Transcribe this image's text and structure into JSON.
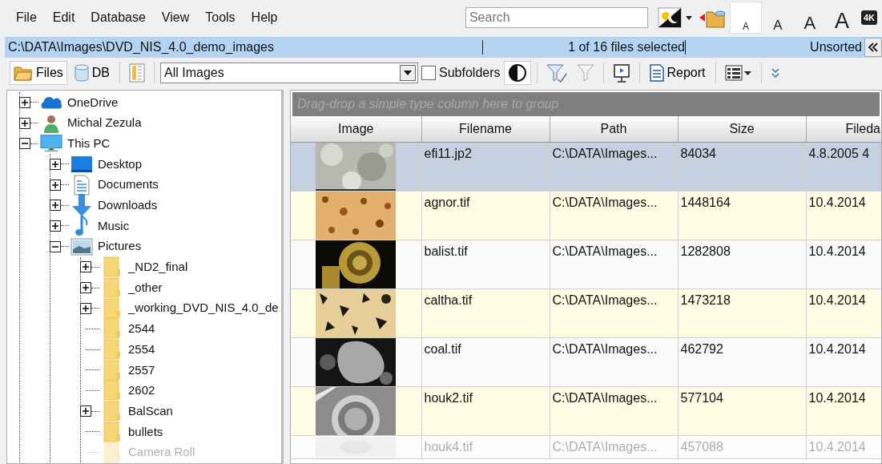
{
  "menu": [
    "File",
    "Edit",
    "Database",
    "View",
    "Tools",
    "Help"
  ],
  "search": {
    "placeholder": "Search"
  },
  "font_sizes": [
    {
      "label": "A",
      "selected": true
    },
    {
      "label": "A",
      "selected": false
    },
    {
      "label": "A",
      "selected": false
    },
    {
      "label": "A",
      "selected": false
    }
  ],
  "resolution_badge": "4K",
  "path_bar": {
    "path": "C:\\DATA\\Images\\DVD_NIS_4.0_demo_images",
    "selection": "1 of 16 files selected",
    "sort": "Unsorted"
  },
  "toolbar": {
    "sources": [
      {
        "label": "Files",
        "kind": "folder",
        "selected": true
      },
      {
        "label": "DB",
        "kind": "db",
        "selected": false
      }
    ],
    "filter": "All Images",
    "subfolders": {
      "label": "Subfolders",
      "checked": false
    },
    "report": "Report"
  },
  "tree": [
    {
      "label": "OneDrive",
      "kind": "cloud",
      "expanded": false
    },
    {
      "label": "Michal Zezula",
      "kind": "user",
      "expanded": false
    },
    {
      "label": "This PC",
      "kind": "pc",
      "expanded": true,
      "children": [
        {
          "label": "Desktop",
          "kind": "desktop",
          "expanded": false
        },
        {
          "label": "Documents",
          "kind": "document",
          "expanded": false
        },
        {
          "label": "Downloads",
          "kind": "download",
          "expanded": false
        },
        {
          "label": "Music",
          "kind": "music",
          "expanded": false
        },
        {
          "label": "Pictures",
          "kind": "pictures",
          "expanded": true,
          "children": [
            {
              "label": "_ND2_final",
              "kind": "folder",
              "expanded": false
            },
            {
              "label": "_other",
              "kind": "folder",
              "expanded": false
            },
            {
              "label": "_working_DVD_NIS_4.0_de",
              "kind": "folder",
              "expanded": false
            },
            {
              "label": "2544",
              "kind": "folder"
            },
            {
              "label": "2554",
              "kind": "folder"
            },
            {
              "label": "2557",
              "kind": "folder"
            },
            {
              "label": "2602",
              "kind": "folder"
            },
            {
              "label": "BalScan",
              "kind": "folder",
              "expanded": false
            },
            {
              "label": "bullets",
              "kind": "folder"
            },
            {
              "label": "Camera Roll",
              "kind": "folder",
              "faded": true
            }
          ]
        }
      ]
    }
  ],
  "grid": {
    "group_hint": "Drag-drop a simple type column here to group",
    "columns": [
      "Image",
      "Filename",
      "Path",
      "Size",
      "Fileda"
    ],
    "rows": [
      {
        "filename": "efi11.jp2",
        "path": "C:\\DATA\\Images...",
        "size": "84034",
        "filedate": "4.8.2005  4",
        "selected": true
      },
      {
        "filename": "agnor.tif",
        "path": "C:\\DATA\\Images...",
        "size": "1448164",
        "filedate": "10.4.2014",
        "selected": false
      },
      {
        "filename": "balist.tif",
        "path": "C:\\DATA\\Images...",
        "size": "1282808",
        "filedate": "10.4.2014",
        "selected": false
      },
      {
        "filename": "caltha.tif",
        "path": "C:\\DATA\\Images...",
        "size": "1473218",
        "filedate": "10.4.2014",
        "selected": false
      },
      {
        "filename": "coal.tif",
        "path": "C:\\DATA\\Images...",
        "size": "462792",
        "filedate": "10.4.2014",
        "selected": false
      },
      {
        "filename": "houk2.tif",
        "path": "C:\\DATA\\Images...",
        "size": "577104",
        "filedate": "10.4.2014",
        "selected": false
      },
      {
        "filename": "houk4.tif",
        "path": "C:\\DATA\\Images...",
        "size": "457088",
        "filedate": "10.4.2014",
        "selected": false,
        "faded": true
      }
    ]
  }
}
